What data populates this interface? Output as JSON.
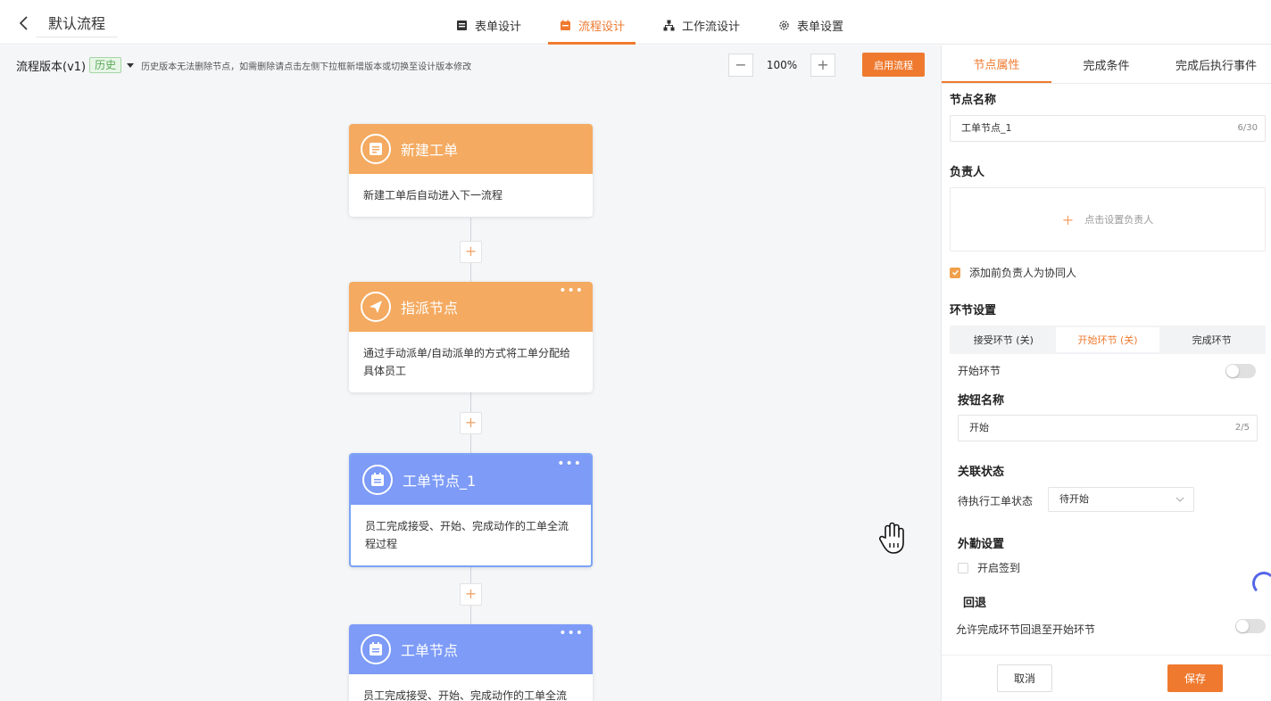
{
  "header": {
    "title": "默认流程",
    "tabs": [
      {
        "label": "表单设计",
        "icon": "form-icon"
      },
      {
        "label": "流程设计",
        "icon": "flow-icon"
      },
      {
        "label": "工作流设计",
        "icon": "workflow-icon"
      },
      {
        "label": "表单设置",
        "icon": "gear-icon"
      }
    ],
    "active_tab": 1
  },
  "toolbar": {
    "version_label": "流程版本(v1)",
    "history_tag": "历史",
    "hint": "历史版本无法删除节点，如需删除请点击左侧下拉框新增版本或切换至设计版本修改",
    "zoom_value": "100%",
    "zoom_minus": "−",
    "zoom_plus": "+",
    "enable_label": "启用流程"
  },
  "nodes": [
    {
      "title": "新建工单",
      "desc": "新建工单后自动进入下一流程",
      "color": "#f4aa60",
      "icon": "document-icon"
    },
    {
      "title": "指派节点",
      "desc": "通过手动派单/自动派单的方式将工单分配给具体员工",
      "color": "#f4aa60",
      "icon": "send-icon"
    },
    {
      "title": "工单节点_1",
      "desc": "员工完成接受、开始、完成动作的工单全流程过程",
      "color": "#7d9bf7",
      "icon": "calendar-icon"
    },
    {
      "title": "工单节点",
      "desc": "员工完成接受、开始、完成动作的工单全流",
      "color": "#7d9bf7",
      "icon": "calendar-icon"
    }
  ],
  "node_more": "•••",
  "add_symbol": "+",
  "panel": {
    "tabs": [
      "节点属性",
      "完成条件",
      "完成后执行事件"
    ],
    "active_tab": 0,
    "node_name_title": "节点名称",
    "node_name_value": "工单节点_1",
    "node_name_count": "6/30",
    "assignee_title": "负责人",
    "assignee_placeholder": "点击设置负责人",
    "add_prev_assignee": "添加前负责人为协同人",
    "stage_title": "环节设置",
    "stages": [
      "接受环节 (关)",
      "开始环节 (关)",
      "完成环节"
    ],
    "active_stage": 1,
    "start_stage_label": "开始环节",
    "button_name_title": "按钮名称",
    "button_name_value": "开始",
    "button_name_count": "2/5",
    "status_title": "关联状态",
    "status_label": "待执行工单状态",
    "status_value": "待开始",
    "field_title": "外勤设置",
    "checkin_label": "开启签到",
    "rollback_title": "回退",
    "rollback_label": "允许完成环节回退至开始环节",
    "cancel_label": "取消",
    "save_label": "保存"
  },
  "colors": {
    "accent": "#ef7a2f",
    "orange_node": "#f4aa60",
    "blue_node": "#7d9bf7"
  }
}
